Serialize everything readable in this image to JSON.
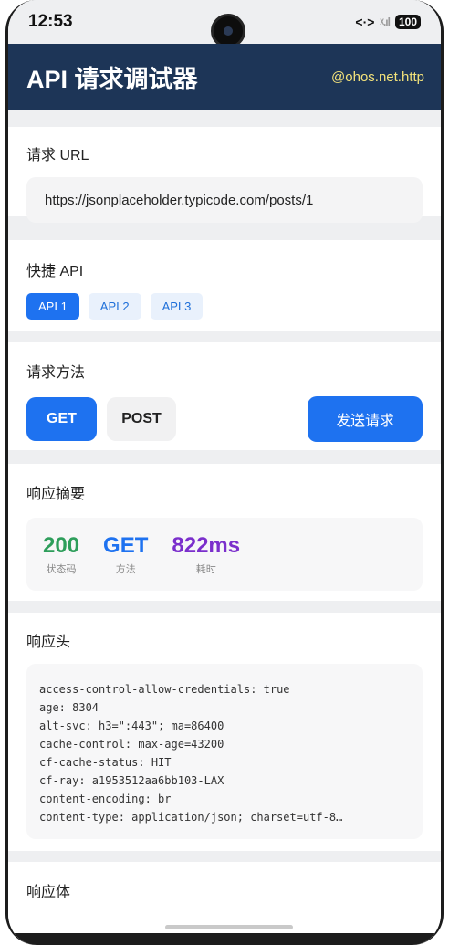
{
  "status_bar": {
    "time": "12:53",
    "signal": "ᵡ.ıl",
    "battery": "100"
  },
  "header": {
    "title": "API 请求调试器",
    "subtitle": "@ohos.net.http"
  },
  "url_section": {
    "title": "请求 URL",
    "url": "https://jsonplaceholder.typicode.com/posts/1"
  },
  "quick_api": {
    "title": "快捷 API",
    "buttons": [
      "API 1",
      "API 2",
      "API 3"
    ],
    "active": "API 1"
  },
  "method": {
    "title": "请求方法",
    "get_label": "GET",
    "post_label": "POST",
    "send_label": "发送请求",
    "selected": "GET"
  },
  "summary": {
    "title": "响应摘要",
    "status_value": "200",
    "status_label": "状态码",
    "status_color": "#2e9e5b",
    "method_value": "GET",
    "method_label": "方法",
    "method_color": "#1e72f0",
    "time_value": "822ms",
    "time_label": "耗时",
    "time_color": "#7b2fcc"
  },
  "response_headers": {
    "title": "响应头",
    "lines": [
      "access-control-allow-credentials: true",
      "age: 8304",
      "alt-svc: h3=\":443\"; ma=86400",
      "cache-control: max-age=43200",
      "cf-cache-status: HIT",
      "cf-ray: a1953512aa6bb103-LAX",
      "content-encoding: br",
      "content-type: application/json; charset=utf-8…"
    ]
  },
  "response_body": {
    "title": "响应体"
  },
  "colors": {
    "header_bg": "#1d3557",
    "accent": "#1e72f0",
    "subtitle": "#f3e27a"
  }
}
